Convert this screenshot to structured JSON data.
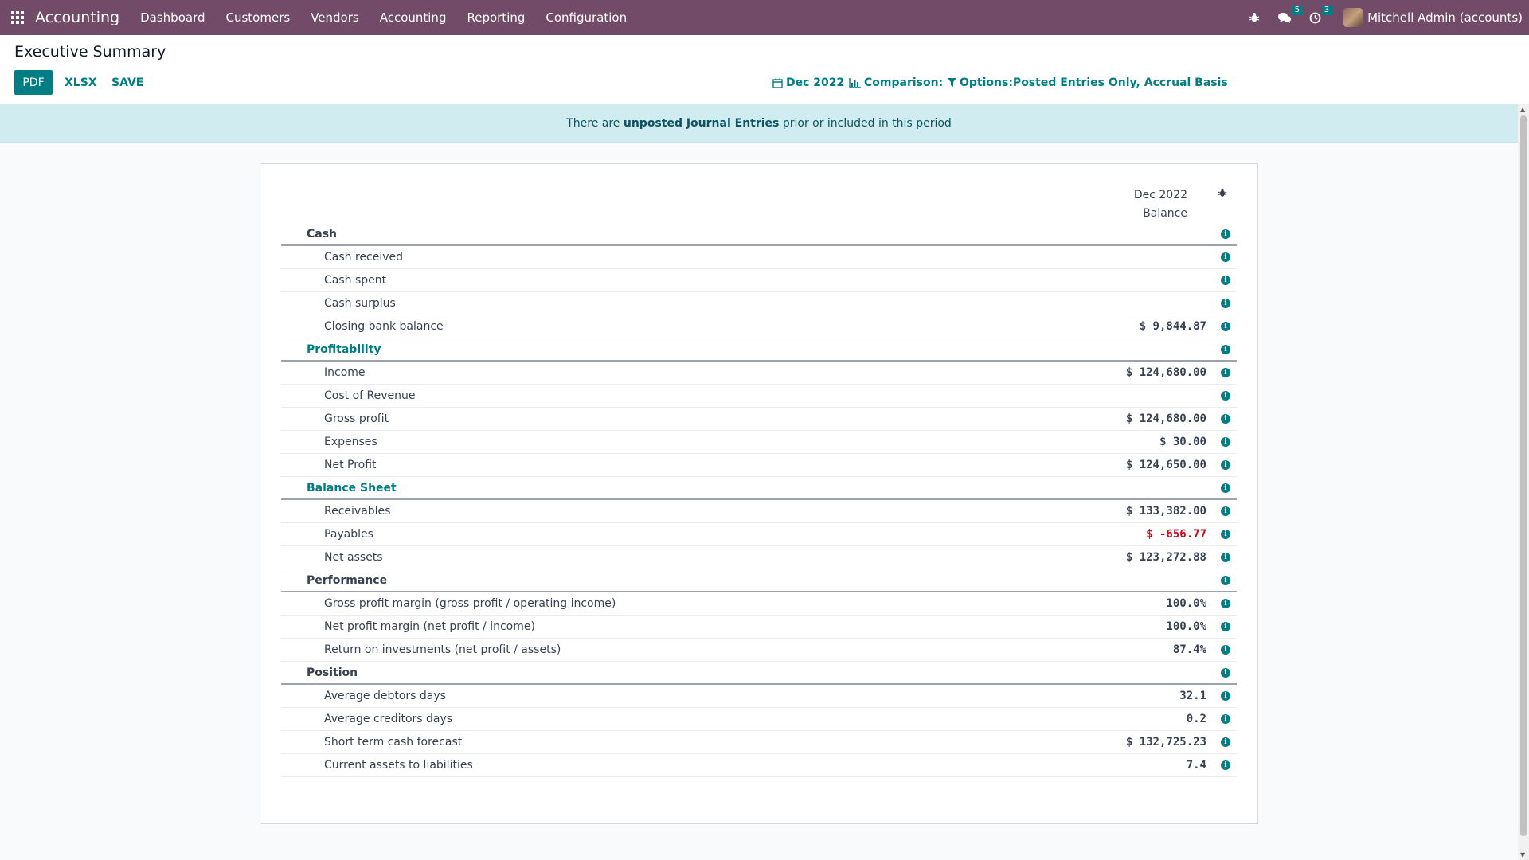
{
  "navbar": {
    "brand": "Accounting",
    "menu": [
      "Dashboard",
      "Customers",
      "Vendors",
      "Accounting",
      "Reporting",
      "Configuration"
    ],
    "messages_count": "5",
    "activities_count": "3",
    "user_name": "Mitchell Admin (accounts)",
    "accent_color": "#714b67"
  },
  "control_panel": {
    "title": "Executive Summary",
    "buttons": {
      "pdf": "PDF",
      "xlsx": "XLSX",
      "save": "SAVE"
    },
    "filters": {
      "date": "Dec 2022",
      "comparison": "Comparison:",
      "options": "Options:Posted Entries Only, Accrual Basis"
    }
  },
  "alert": {
    "prefix": "There are",
    "link": "unposted Journal Entries",
    "suffix": "prior or included in this period"
  },
  "report": {
    "column_period": "Dec 2022",
    "column_name": "Balance",
    "rows": [
      {
        "type": "section",
        "label": "Cash",
        "value": "",
        "accent": false
      },
      {
        "type": "line",
        "label": "Cash received",
        "value": ""
      },
      {
        "type": "line",
        "label": "Cash spent",
        "value": ""
      },
      {
        "type": "line",
        "label": "Cash surplus",
        "value": ""
      },
      {
        "type": "line",
        "label": "Closing bank balance",
        "value": "$ 9,844.87"
      },
      {
        "type": "section",
        "label": "Profitability",
        "value": "",
        "accent": true
      },
      {
        "type": "line",
        "label": "Income",
        "value": "$ 124,680.00"
      },
      {
        "type": "line",
        "label": "Cost of Revenue",
        "value": ""
      },
      {
        "type": "line",
        "label": "Gross profit",
        "value": "$ 124,680.00"
      },
      {
        "type": "line",
        "label": "Expenses",
        "value": "$ 30.00"
      },
      {
        "type": "line",
        "label": "Net Profit",
        "value": "$ 124,650.00"
      },
      {
        "type": "section",
        "label": "Balance Sheet",
        "value": "",
        "accent": true
      },
      {
        "type": "line",
        "label": "Receivables",
        "value": "$ 133,382.00"
      },
      {
        "type": "line",
        "label": "Payables",
        "value": "$ -656.77",
        "negative": true
      },
      {
        "type": "line",
        "label": "Net assets",
        "value": "$ 123,272.88"
      },
      {
        "type": "section",
        "label": "Performance",
        "value": "",
        "accent": false
      },
      {
        "type": "line",
        "label": "Gross profit margin (gross profit / operating income)",
        "value": "100.0%"
      },
      {
        "type": "line",
        "label": "Net profit margin (net profit / income)",
        "value": "100.0%"
      },
      {
        "type": "line",
        "label": "Return on investments (net profit / assets)",
        "value": "87.4%"
      },
      {
        "type": "section",
        "label": "Position",
        "value": "",
        "accent": false
      },
      {
        "type": "line",
        "label": "Average debtors days",
        "value": "32.1"
      },
      {
        "type": "line",
        "label": "Average creditors days",
        "value": "0.2"
      },
      {
        "type": "line",
        "label": "Short term cash forecast",
        "value": "$ 132,725.23"
      },
      {
        "type": "line",
        "label": "Current assets to liabilities",
        "value": "7.4"
      }
    ]
  },
  "colors": {
    "primary": "#017e84",
    "negative": "#d9001b",
    "alert_bg": "#d1ecf1"
  }
}
